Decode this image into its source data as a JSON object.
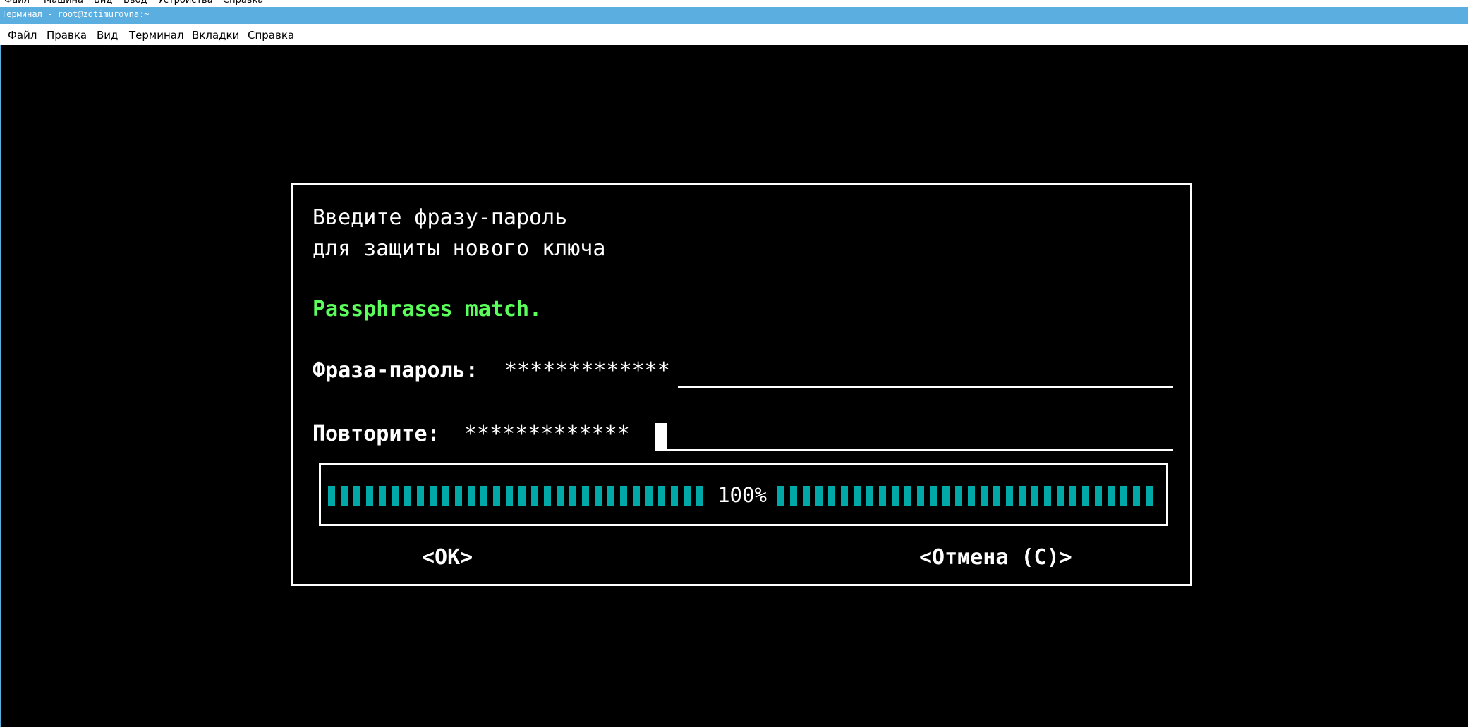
{
  "host_menu": {
    "items": [
      "Файл",
      "Машина",
      "Вид",
      "Ввод",
      "Устройства",
      "Справка"
    ]
  },
  "window": {
    "title": "Терминал - root@zdtimurovna:~"
  },
  "menubar": {
    "items": [
      "Файл",
      "Правка",
      "Вид",
      "Терминал",
      "Вкладки",
      "Справка"
    ]
  },
  "dialog": {
    "prompt_line1": "Введите фразу-пароль",
    "prompt_line2": "для защиты нового ключа",
    "status": "Passphrases match.",
    "status_color": "#5bff5b",
    "passphrase_label": "Фраза-пароль:",
    "passphrase_value": "*************",
    "repeat_label": "Повторите:",
    "repeat_value": "*************",
    "progress_label": "100%",
    "progress_fraction": 1.0,
    "progress_color": "#00a8a8",
    "ok_button": "<OK>",
    "cancel_button": "<Отмена (C)>"
  }
}
